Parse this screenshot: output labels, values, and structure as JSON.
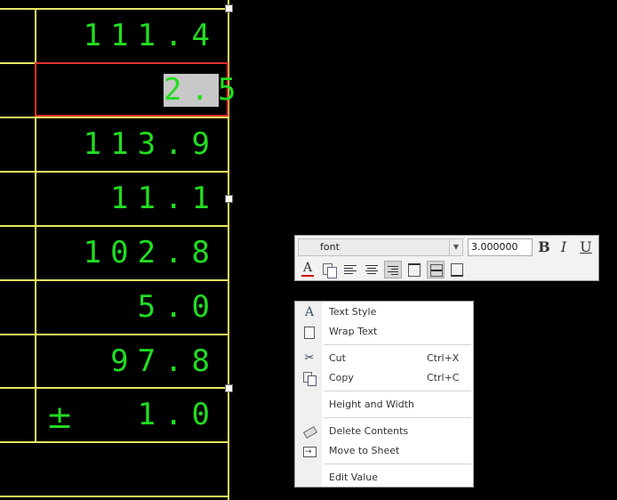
{
  "table": {
    "values": [
      "111.4",
      "2.5",
      "113.9",
      "11.1",
      "102.8",
      "5.0",
      "97.8",
      "1.0"
    ],
    "plus_minus": "±"
  },
  "toolbar": {
    "font_label": "font",
    "font_size": "3.000000",
    "bold": "B",
    "italic": "I",
    "underline": "U",
    "text_color_glyph": "A"
  },
  "menu": {
    "items": [
      {
        "label": "Text Style",
        "shortcut": "",
        "icon": "text-style-icon"
      },
      {
        "label": "Wrap Text",
        "shortcut": "",
        "icon": "wrap-text-icon"
      },
      {
        "label": "Cut",
        "shortcut": "Ctrl+X",
        "icon": "scissors-icon"
      },
      {
        "label": "Copy",
        "shortcut": "Ctrl+C",
        "icon": "copy-icon"
      },
      {
        "label": "Height and Width",
        "shortcut": "",
        "icon": ""
      },
      {
        "label": "Delete Contents",
        "shortcut": "",
        "icon": "eraser-icon"
      },
      {
        "label": "Move to Sheet",
        "shortcut": "",
        "icon": "move-to-sheet-icon"
      },
      {
        "label": "Edit Value",
        "shortcut": "",
        "icon": ""
      }
    ]
  }
}
